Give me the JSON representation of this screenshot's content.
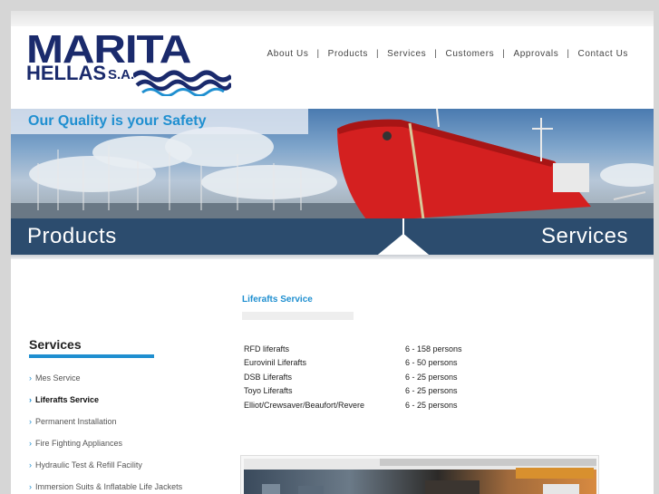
{
  "logo": {
    "name": "MARITA",
    "sub": "HELLAS",
    "suffix": "S.A."
  },
  "nav": {
    "items": [
      "About Us",
      "Products",
      "Services",
      "Customers",
      "Approvals",
      "Contact Us"
    ],
    "separator": "|"
  },
  "banner": {
    "tagline": "Our Quality is your Safety"
  },
  "tabs": {
    "left": "Products",
    "right": "Services"
  },
  "sidebar": {
    "title": "Services",
    "items": [
      {
        "label": "Mes Service",
        "active": false
      },
      {
        "label": "Liferafts Service",
        "active": true
      },
      {
        "label": "Permanent Installation",
        "active": false
      },
      {
        "label": "Fire Fighting Appliances",
        "active": false
      },
      {
        "label": "Hydraulic Test & Refill Facility",
        "active": false
      },
      {
        "label": "Immersion Suits & Inflatable Life Jackets",
        "active": false
      }
    ]
  },
  "content": {
    "title": "Liferafts Service",
    "rafts": [
      {
        "name": "RFD liferafts",
        "capacity": "6 - 158 persons"
      },
      {
        "name": "Eurovinil Liferafts",
        "capacity": "6 - 50 persons"
      },
      {
        "name": "DSB Liferafts",
        "capacity": "6 - 25 persons"
      },
      {
        "name": "Toyo Liferafts",
        "capacity": "6 - 25 persons"
      },
      {
        "name": "Elliot/Crewsaver/Beaufort/Revere",
        "capacity": "6 - 25 persons"
      }
    ]
  },
  "colors": {
    "brand": "#1a2a6c",
    "accent": "#1f8fd0",
    "tab": "#2c4c6e",
    "ship": "#d42020"
  },
  "icons": {
    "bullet": "arrow-right-icon",
    "waves": "waves-icon"
  }
}
